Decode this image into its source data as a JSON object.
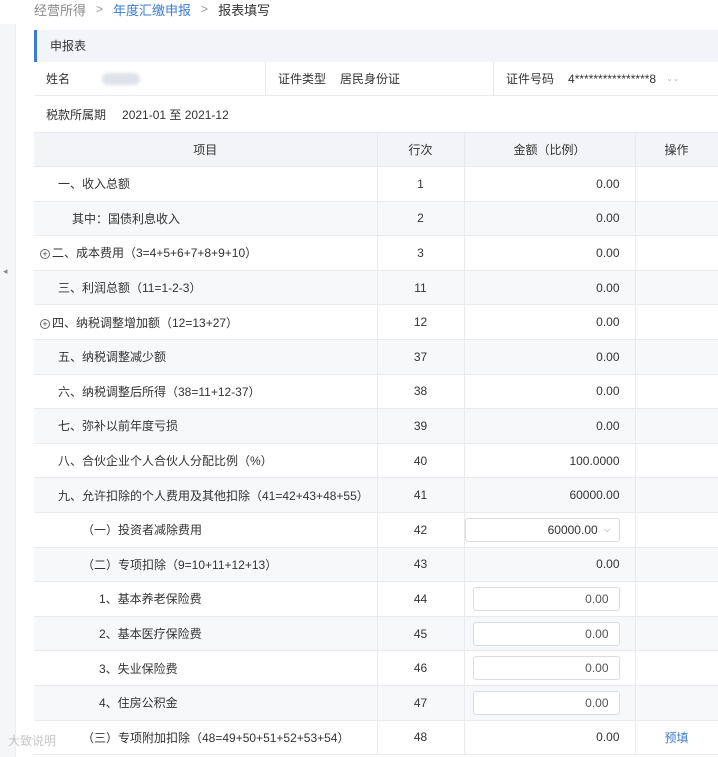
{
  "breadcrumb": [
    {
      "label": "经营所得",
      "style": "crumb"
    },
    {
      "label": "年度汇缴申报",
      "style": "crumb link"
    },
    {
      "label": "报表填写",
      "style": "crumb current"
    }
  ],
  "panel": {
    "title": "申报表"
  },
  "taxpayer": {
    "name_label": "姓名",
    "id_type_label": "证件类型",
    "id_type_value": "居民身份证",
    "id_no_label": "证件号码",
    "id_no_value": "4****************8"
  },
  "period": {
    "label": "税款所属期",
    "value": "2021-01 至 2021-12"
  },
  "table": {
    "headers": {
      "item": "项目",
      "row_no": "行次",
      "amount": "金额（比例）",
      "op": "操作"
    },
    "rows": [
      {
        "item": "一、收入总额",
        "row_no": "1",
        "amount": "0.00"
      },
      {
        "item": "其中：国债利息收入",
        "row_no": "2",
        "amount": "0.00"
      },
      {
        "item": "二、成本费用（3=4+5+6+7+8+9+10）",
        "row_no": "3",
        "amount": "0.00"
      },
      {
        "item": "三、利润总额（11=1-2-3）",
        "row_no": "11",
        "amount": "0.00"
      },
      {
        "item": "四、纳税调整增加额（12=13+27）",
        "row_no": "12",
        "amount": "0.00"
      },
      {
        "item": "五、纳税调整减少额",
        "row_no": "37",
        "amount": "0.00"
      },
      {
        "item": "六、纳税调整后所得（38=11+12-37）",
        "row_no": "38",
        "amount": "0.00"
      },
      {
        "item": "七、弥补以前年度亏损",
        "row_no": "39",
        "amount": "0.00"
      },
      {
        "item": "八、合伙企业个人合伙人分配比例（%）",
        "row_no": "40",
        "amount": "100.0000"
      },
      {
        "item": "九、允许扣除的个人费用及其他扣除（41=42+43+48+55）",
        "row_no": "41",
        "amount": "60000.00"
      },
      {
        "item": "（一）投资者减除费用",
        "row_no": "42",
        "amount": "60000.00"
      },
      {
        "item": "（二）专项扣除（9=10+11+12+13）",
        "row_no": "43",
        "amount": "0.00"
      },
      {
        "item": "1、基本养老保险费",
        "row_no": "44",
        "amount": "0.00"
      },
      {
        "item": "2、基本医疗保险费",
        "row_no": "45",
        "amount": "0.00"
      },
      {
        "item": "3、失业保险费",
        "row_no": "46",
        "amount": "0.00"
      },
      {
        "item": "4、住房公积金",
        "row_no": "47",
        "amount": "0.00"
      },
      {
        "item": "（三）专项附加扣除（48=49+50+51+52+53+54）",
        "row_no": "48",
        "amount": "0.00",
        "op": "预填"
      }
    ],
    "expand_icon": "+"
  },
  "icons": {
    "collapse": "◂",
    "select_chevron": "⌵"
  },
  "watermark": "大致说明"
}
